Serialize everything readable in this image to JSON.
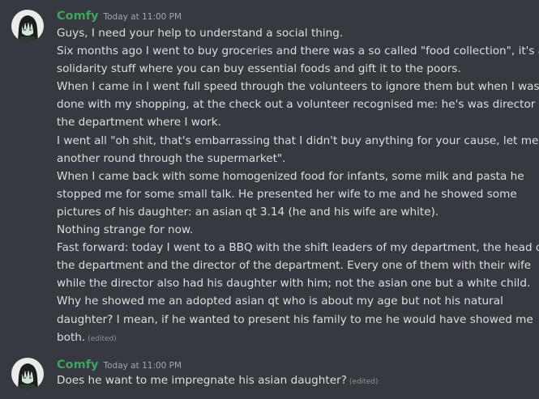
{
  "messages": [
    {
      "author": "Comfy",
      "timestamp": "Today at 11:00 PM",
      "lines": [
        "Guys, I need your help to understand a social thing.",
        "Six months ago I went to buy groceries and there was a so called \"food collection\", it's a",
        "solidarity stuff where you can buy essential foods and gift it to the poors.",
        "When I came in I went full speed through the volunteers to ignore them but when I was",
        "done with my shopping, at the check out a volunteer recognised me: he's was director of",
        "the department where I work.",
        "I went all \"oh shit, that's embarrassing that I didn't buy anything for your cause, let me go",
        "another round through the supermarket\".",
        "When I came back with some homogenized food for infants, some milk and pasta he",
        "stopped me for some small talk. He presented her wife to me and he showed some",
        "pictures of his daughter: an asian qt 3.14 (he and his wife are white).",
        "Nothing strange for now.",
        "Fast forward: today I went to a BBQ with the shift leaders of my department, the head of",
        "the department and the director of the department. Every one of them with their wife",
        "while the director also had his daughter with him; not the asian one but a white child.",
        "Why he showed me an adopted asian qt who is about my age but not his natural",
        "daughter? I mean, if he wanted to present his family to me he would have showed me",
        "both."
      ],
      "edited_label": "(edited)"
    },
    {
      "author": "Comfy",
      "timestamp": "Today at 11:00 PM",
      "lines": [
        "Does he want to me impregnate his asian daughter?"
      ],
      "edited_label": "(edited)"
    }
  ],
  "colors": {
    "background": "#36393f",
    "username": "#3ba55d",
    "message_text": "#dcddde",
    "timestamp": "#a3a6aa",
    "edited": "#8e9297"
  },
  "icons": {
    "avatar": "anime-avatar-icon"
  }
}
